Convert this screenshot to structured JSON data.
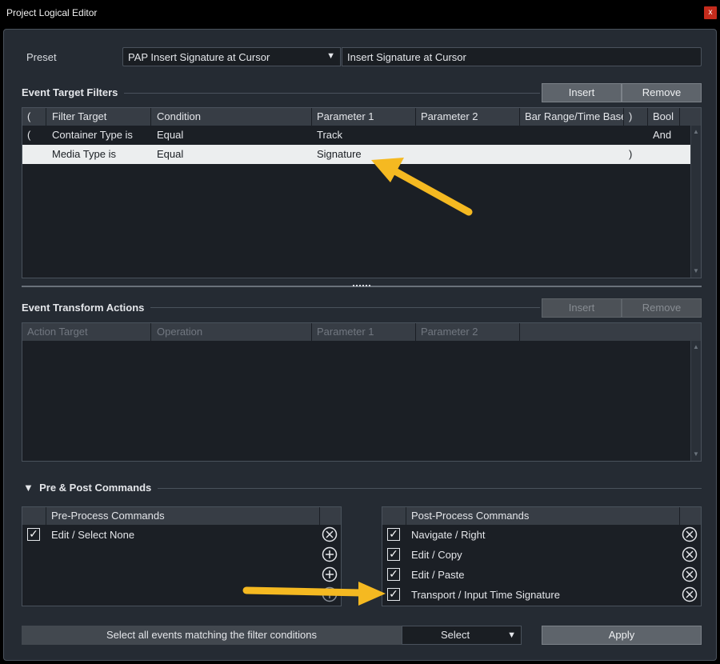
{
  "window": {
    "title": "Project Logical Editor",
    "close_label": "x"
  },
  "preset": {
    "label": "Preset",
    "selected": "PAP Insert Signature at Cursor",
    "name_value": "Insert Signature at Cursor"
  },
  "filters": {
    "title": "Event Target Filters",
    "insert_label": "Insert",
    "remove_label": "Remove",
    "columns": [
      "(",
      "Filter Target",
      "Condition",
      "Parameter 1",
      "Parameter 2",
      "Bar Range/Time Base",
      ")",
      "Bool"
    ],
    "rows": [
      [
        "(",
        "Container Type is",
        "Equal",
        "Track",
        "",
        "",
        "",
        "And"
      ],
      [
        "",
        "Media Type is",
        "Equal",
        "Signature",
        "",
        "",
        ")",
        ""
      ]
    ]
  },
  "actions": {
    "title": "Event Transform Actions",
    "insert_label": "Insert",
    "remove_label": "Remove",
    "columns": [
      "Action Target",
      "Operation",
      "Parameter 1",
      "Parameter 2"
    ]
  },
  "commands": {
    "title": "Pre & Post Commands",
    "toggle_glyph": "▼",
    "pre": {
      "header": "Pre-Process Commands",
      "items": [
        {
          "label": "Edit / Select None",
          "checked": true
        }
      ]
    },
    "post": {
      "header": "Post-Process Commands",
      "items": [
        {
          "label": "Navigate / Right",
          "checked": true
        },
        {
          "label": "Edit / Copy",
          "checked": true
        },
        {
          "label": "Edit / Paste",
          "checked": true
        },
        {
          "label": "Transport / Input Time Signature",
          "checked": true
        }
      ]
    }
  },
  "footer": {
    "description": "Select all events matching the filter conditions",
    "function_value": "Select",
    "apply_label": "Apply"
  },
  "colors": {
    "accent_arrow": "#f5b921",
    "dialog_bg": "#252b33",
    "table_bg": "#1b1f25",
    "header_bg": "#373d45",
    "selected_row": "#eceeef"
  },
  "icons": {
    "remove": "circle-x-icon",
    "add": "circle-plus-icon",
    "check": "checkmark-icon",
    "dropdown": "caret-down-icon"
  }
}
